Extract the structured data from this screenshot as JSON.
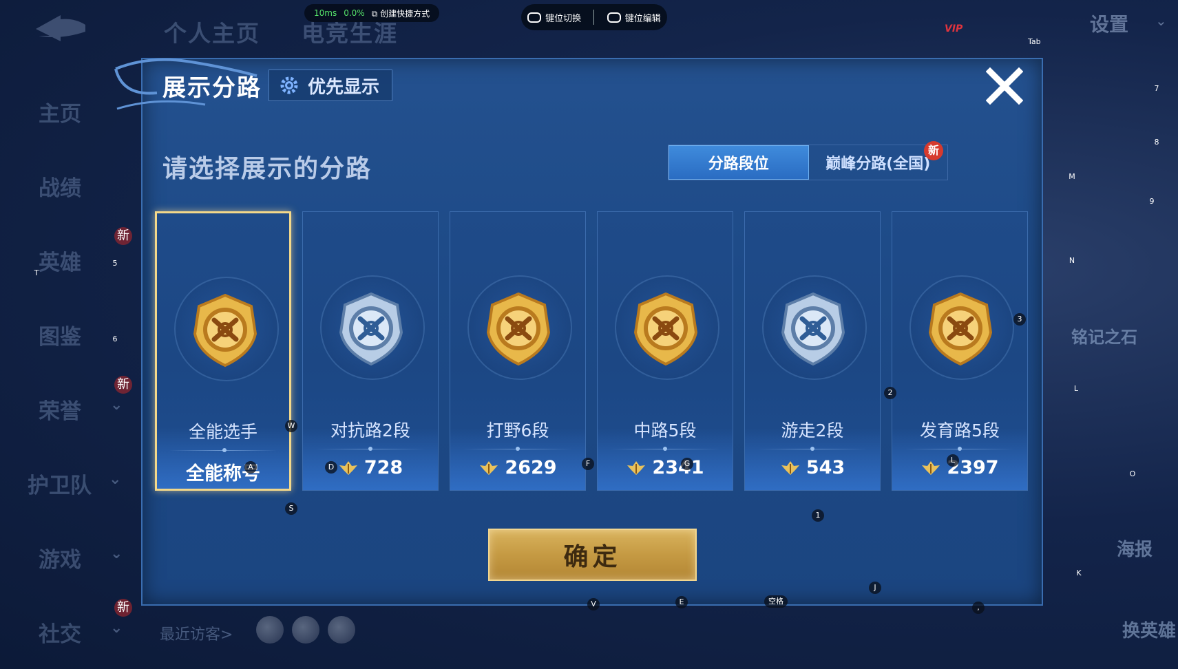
{
  "perf": {
    "ping": "10ms",
    "loss": "0.0%",
    "shortcut": "创建快捷方式"
  },
  "keymap": {
    "switch": "键位切换",
    "edit": "键位编辑"
  },
  "top_tabs": [
    "个人主页",
    "电竞生涯"
  ],
  "settings_label": "设置",
  "vip_label": "VIP",
  "nav": [
    {
      "label": "主页"
    },
    {
      "label": "战绩"
    },
    {
      "label": "英雄",
      "badge": "新"
    },
    {
      "label": "图鉴"
    },
    {
      "label": "荣誉",
      "badge": "新"
    },
    {
      "label": "护卫队"
    },
    {
      "label": "游戏"
    },
    {
      "label": "社交",
      "badge": "新"
    }
  ],
  "recent_visitors": "最近访客>",
  "right_side": {
    "poster": "海报",
    "swap_hero": "换英雄",
    "stone": "铭记之石"
  },
  "dialog": {
    "title": "展示分路",
    "priority_label": "优先显示",
    "subtitle": "请选择展示的分路",
    "tabs": [
      {
        "label": "分路段位",
        "active": true
      },
      {
        "label": "巅峰分路(全国)",
        "badge": "新"
      }
    ],
    "confirm": "确定"
  },
  "lanes": [
    {
      "name": "全能选手",
      "value": "全能称号",
      "selected": true,
      "emblem": "all-round-emblem-icon",
      "tone": "gold"
    },
    {
      "name": "对抗路2段",
      "value": "728",
      "selected": false,
      "emblem": "clash-lane-emblem-icon",
      "tone": "silver"
    },
    {
      "name": "打野6段",
      "value": "2629",
      "selected": false,
      "emblem": "jungle-emblem-icon",
      "tone": "gold"
    },
    {
      "name": "中路5段",
      "value": "2341",
      "selected": false,
      "emblem": "mid-lane-emblem-icon",
      "tone": "gold"
    },
    {
      "name": "游走2段",
      "value": "543",
      "selected": false,
      "emblem": "roam-emblem-icon",
      "tone": "silver"
    },
    {
      "name": "发育路5段",
      "value": "2397",
      "selected": false,
      "emblem": "farm-lane-emblem-icon",
      "tone": "gold"
    }
  ],
  "key_hints": [
    "Tab",
    "7",
    "8",
    "M",
    "9",
    "N",
    "3",
    "2",
    "L",
    "O",
    "K",
    "1",
    "J",
    "空格",
    ",",
    "V",
    "E",
    "S",
    "W",
    "A",
    "D",
    "F",
    "G",
    "L",
    "5",
    "6",
    "T"
  ],
  "colors": {
    "gold_border": "#f3d88a",
    "active_tab": "#3f8bdc",
    "confirm": "#c59a43",
    "dialog_bg": "#1d4a87"
  }
}
